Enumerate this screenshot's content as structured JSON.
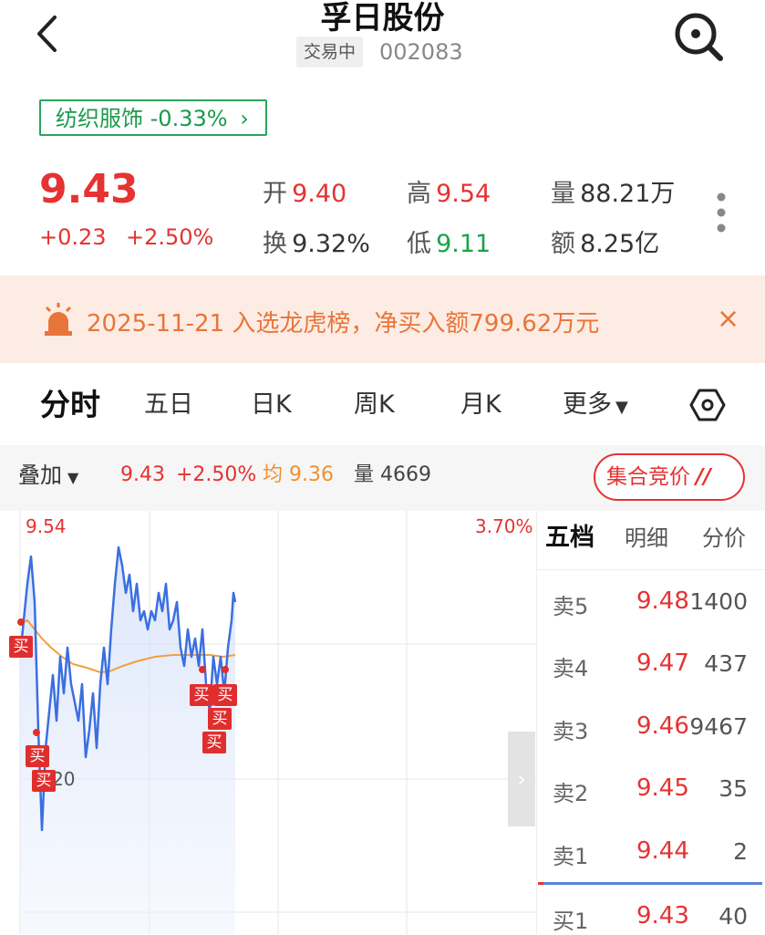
{
  "header": {
    "title": "孚日股份",
    "status": "交易中",
    "code": "002083"
  },
  "sector": {
    "name": "纺织服饰",
    "change": "-0.33%",
    "arrow": "›"
  },
  "quote": {
    "price": "9.43",
    "change": "+0.23",
    "change_pct": "+2.50%",
    "open_label": "开",
    "open": "9.40",
    "high_label": "高",
    "high": "9.54",
    "volume_label": "量",
    "volume": "88.21万",
    "turnover_label": "换",
    "turnover": "9.32%",
    "low_label": "低",
    "low": "9.11",
    "amount_label": "额",
    "amount": "8.25亿"
  },
  "banner": {
    "text": "2025-11-21 入选龙虎榜，净买入额799.62万元",
    "close": "×"
  },
  "tabs": [
    "分时",
    "五日",
    "日K",
    "周K",
    "月K",
    "更多"
  ],
  "overlay": {
    "label": "叠加",
    "price": "9.43",
    "pct": "+2.50%",
    "avg_label": "均",
    "avg": "9.36",
    "vol_label": "量",
    "vol": "4669",
    "auction": "集合竞价"
  },
  "chart": {
    "high_label": "9.54",
    "pct_label": "3.70%",
    "mid_label": "9.20",
    "buy_tag": "买",
    "line_color": "#3b6fe0",
    "avg_color": "#f0a040"
  },
  "orderbook": {
    "tabs": [
      "五档",
      "明细",
      "分价"
    ],
    "rows": [
      {
        "label": "卖5",
        "price": "9.48",
        "vol": "1400"
      },
      {
        "label": "卖4",
        "price": "9.47",
        "vol": "437"
      },
      {
        "label": "卖3",
        "price": "9.46",
        "vol": "9467"
      },
      {
        "label": "卖2",
        "price": "9.45",
        "vol": "35"
      },
      {
        "label": "卖1",
        "price": "9.44",
        "vol": "2"
      },
      {
        "label": "买1",
        "price": "9.43",
        "vol": "40"
      }
    ]
  },
  "colors": {
    "up": "#e63232",
    "down": "#1aa34a",
    "banner_bg": "#fdece3",
    "banner_text": "#e8753a"
  }
}
